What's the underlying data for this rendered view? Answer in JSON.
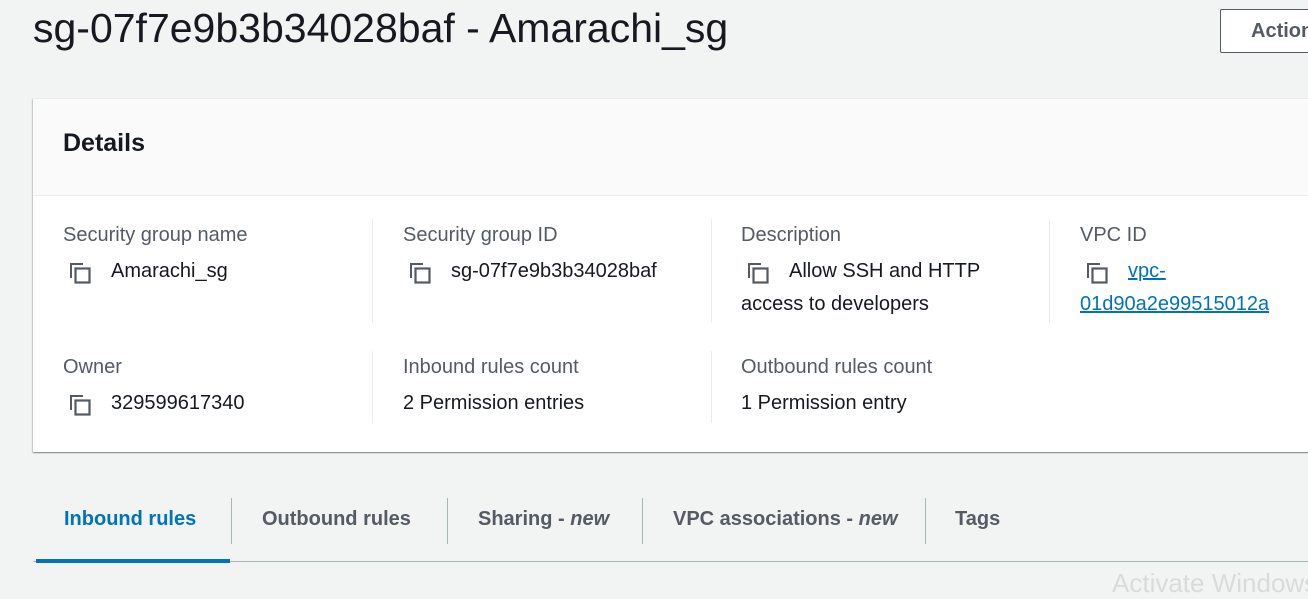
{
  "page": {
    "title": "sg-07f7e9b3b34028baf - Amarachi_sg",
    "actions_label": "Actions"
  },
  "details": {
    "title": "Details",
    "fields": {
      "sg_name": {
        "label": "Security group name",
        "value": "Amarachi_sg"
      },
      "sg_id": {
        "label": "Security group ID",
        "value": "sg-07f7e9b3b34028baf"
      },
      "description": {
        "label": "Description",
        "value_line1": "Allow SSH and HTTP",
        "value_line2": "access to developers"
      },
      "vpc_id": {
        "label": "VPC ID",
        "value_line1": "vpc-",
        "value_line2": "01d90a2e99515012a"
      },
      "owner": {
        "label": "Owner",
        "value": "329599617340"
      },
      "inbound_count": {
        "label": "Inbound rules count",
        "value": "2 Permission entries"
      },
      "outbound_count": {
        "label": "Outbound rules count",
        "value": "1 Permission entry"
      }
    }
  },
  "tabs": [
    {
      "label": "Inbound rules",
      "badge": "",
      "active": true
    },
    {
      "label": "Outbound rules",
      "badge": "",
      "active": false
    },
    {
      "label": "Sharing - ",
      "badge": "new",
      "active": false
    },
    {
      "label": "VPC associations - ",
      "badge": "new",
      "active": false
    },
    {
      "label": "Tags",
      "badge": "",
      "active": false
    }
  ],
  "watermark": "Activate Windows",
  "colors": {
    "link": "#0073bb",
    "label": "#545b64",
    "text": "#16191f",
    "background": "#f2f3f3"
  },
  "icons": {
    "copy": "copy-icon"
  }
}
